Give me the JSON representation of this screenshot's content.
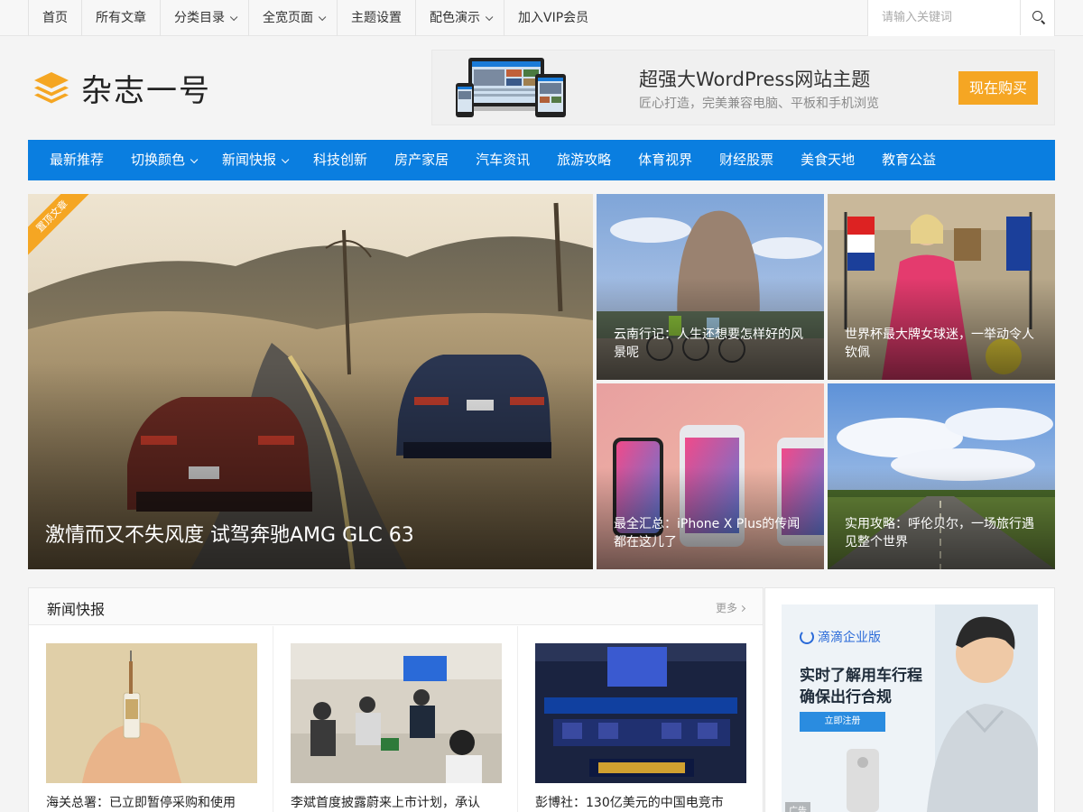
{
  "topnav": {
    "items": [
      {
        "label": "首页",
        "dropdown": false
      },
      {
        "label": "所有文章",
        "dropdown": false
      },
      {
        "label": "分类目录",
        "dropdown": true
      },
      {
        "label": "全宽页面",
        "dropdown": true
      },
      {
        "label": "主题设置",
        "dropdown": false
      },
      {
        "label": "配色演示",
        "dropdown": true
      },
      {
        "label": "加入VIP会员",
        "dropdown": false
      }
    ],
    "search_placeholder": "请输入关键词"
  },
  "logo": {
    "name": "杂志一号",
    "color": "#f5a623"
  },
  "banner": {
    "title": "超强大WordPress网站主题",
    "subtitle": "匠心打造，完美兼容电脑、平板和手机浏览",
    "button": "现在购买"
  },
  "mainnav": {
    "color": "#0a7ee0",
    "items": [
      {
        "label": "最新推荐",
        "dropdown": false
      },
      {
        "label": "切换颜色",
        "dropdown": true
      },
      {
        "label": "新闻快报",
        "dropdown": true
      },
      {
        "label": "科技创新",
        "dropdown": false
      },
      {
        "label": "房产家居",
        "dropdown": false
      },
      {
        "label": "汽车资讯",
        "dropdown": false
      },
      {
        "label": "旅游攻略",
        "dropdown": false
      },
      {
        "label": "体育视界",
        "dropdown": false
      },
      {
        "label": "财经股票",
        "dropdown": false
      },
      {
        "label": "美食天地",
        "dropdown": false
      },
      {
        "label": "教育公益",
        "dropdown": false
      }
    ]
  },
  "hero": {
    "main": {
      "title": "激情而又不失风度 试驾奔驰AMG GLC 63",
      "badge": "置顶文章"
    },
    "tiles": [
      {
        "title": "云南行记：人生还想要怎样好的风景呢"
      },
      {
        "title": "世界杯最大牌女球迷，一举动令人钦佩"
      },
      {
        "title": "最全汇总：iPhone X Plus的传闻都在这儿了"
      },
      {
        "title": "实用攻略：呼伦贝尔，一场旅行遇见整个世界"
      }
    ]
  },
  "news": {
    "title": "新闻快报",
    "more": "更多",
    "items": [
      {
        "caption": "海关总署：已立即暂停采购和使用"
      },
      {
        "caption": "李斌首度披露蔚来上市计划，承认"
      },
      {
        "caption": "彭博社：130亿美元的中国电竞市"
      }
    ]
  },
  "ad": {
    "brand": "滴滴企业版",
    "line1": "实时了解用车行程",
    "line2": "确保出行合规",
    "button": "立即注册",
    "tag": "广告"
  }
}
